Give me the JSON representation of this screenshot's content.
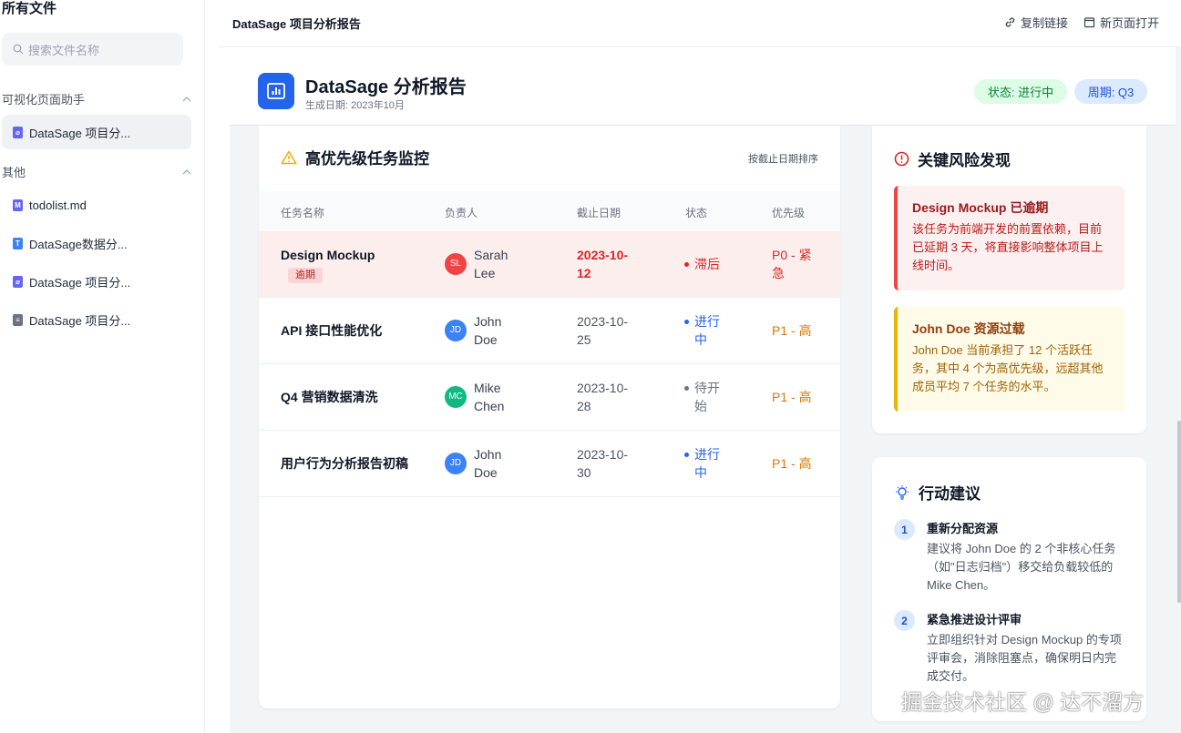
{
  "sidebar": {
    "title": "所有文件",
    "search_placeholder": "搜索文件名称",
    "groups": [
      {
        "label": "可视化页面助手"
      },
      {
        "label": "其他"
      }
    ],
    "items": [
      {
        "label": "DataSage 项目分...",
        "type": "html"
      },
      {
        "label": "todolist.md",
        "type": "md"
      },
      {
        "label": "DataSage数据分...",
        "type": "doc"
      },
      {
        "label": "DataSage 项目分...",
        "type": "html"
      },
      {
        "label": "DataSage 项目分...",
        "type": "file"
      }
    ]
  },
  "topbar": {
    "title": "DataSage 项目分析报告",
    "copy_link": "复制链接",
    "open_new": "新页面打开"
  },
  "report": {
    "title": "DataSage 分析报告",
    "date": "生成日期: 2023年10月",
    "status_pill": "状态: 进行中",
    "period_pill": "周期: Q3"
  },
  "tasks": {
    "title": "高优先级任务监控",
    "sort_label": "按截止日期排序",
    "columns": [
      "任务名称",
      "负责人",
      "截止日期",
      "状态",
      "优先级"
    ],
    "rows": [
      {
        "task": "Design Mockup",
        "badge": "逾期",
        "initials": "SL",
        "owner": "Sarah Lee",
        "avatar_color": "#ef4444",
        "date": "2023-10-12",
        "status": "滞后",
        "status_color": "#dc2626",
        "priority": "P0 - 紧急",
        "priority_color": "#dc2626"
      },
      {
        "task": "API 接口性能优化",
        "badge": "",
        "initials": "JD",
        "owner": "John Doe",
        "avatar_color": "#3b82f6",
        "date": "2023-10-25",
        "status": "进行中",
        "status_color": "#2563eb",
        "priority": "P1 - 高",
        "priority_color": "#d97706"
      },
      {
        "task": "Q4 营销数据清洗",
        "badge": "",
        "initials": "MC",
        "owner": "Mike Chen",
        "avatar_color": "#10b981",
        "date": "2023-10-28",
        "status": "待开始",
        "status_color": "#6b7280",
        "priority": "P1 - 高",
        "priority_color": "#d97706"
      },
      {
        "task": "用户行为分析报告初稿",
        "badge": "",
        "initials": "JD",
        "owner": "John Doe",
        "avatar_color": "#3b82f6",
        "date": "2023-10-30",
        "status": "进行中",
        "status_color": "#2563eb",
        "priority": "P1 - 高",
        "priority_color": "#d97706"
      }
    ]
  },
  "risks": {
    "title": "关键风险发现",
    "alerts": [
      {
        "title": "Design Mockup 已逾期",
        "body": "该任务为前端开发的前置依赖，目前已延期 3 天，将直接影响整体项目上线时间。"
      },
      {
        "title": "John Doe 资源过载",
        "body": "John Doe 当前承担了 12 个活跃任务，其中 4 个为高优先级，远超其他成员平均 7 个任务的水平。"
      }
    ]
  },
  "actions": {
    "title": "行动建议",
    "steps": [
      {
        "num": "1",
        "title": "重新分配资源",
        "body": "建议将 John Doe 的 2 个非核心任务（如\"日志归档\"）移交给负载较低的 Mike Chen。"
      },
      {
        "num": "2",
        "title": "紧急推进设计评审",
        "body": "立即组织针对 Design Mockup 的专项评审会，消除阻塞点，确保明日内完成交付。"
      }
    ]
  },
  "watermark": "掘金技术社区 @ 达不溜方"
}
